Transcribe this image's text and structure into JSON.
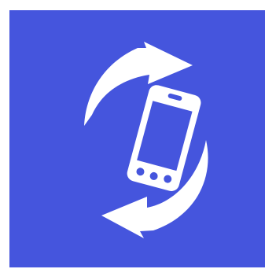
{
  "icon": {
    "name": "screen-rotation-icon",
    "background_color": "#4555DD",
    "foreground_color": "#FFFFFF"
  }
}
